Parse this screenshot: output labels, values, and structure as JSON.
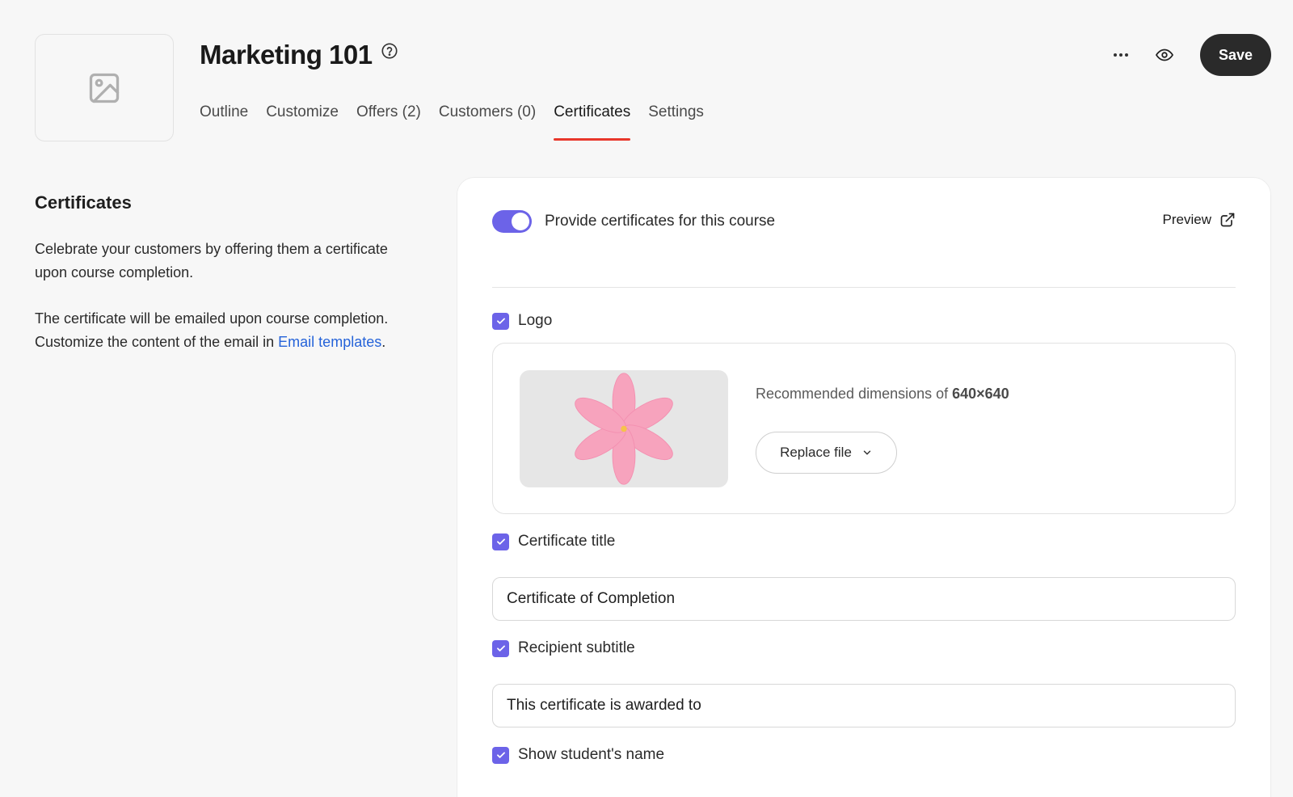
{
  "header": {
    "title": "Marketing 101",
    "thumbnail_icon": "image-placeholder-icon",
    "help_icon": "help-circle-icon",
    "save_label": "Save",
    "more_icon": "more-horizontal-icon",
    "preview_icon": "eye-icon"
  },
  "tabs": [
    {
      "label": "Outline",
      "active": false
    },
    {
      "label": "Customize",
      "active": false
    },
    {
      "label": "Offers (2)",
      "active": false
    },
    {
      "label": "Customers (0)",
      "active": false
    },
    {
      "label": "Certificates",
      "active": true
    },
    {
      "label": "Settings",
      "active": false
    }
  ],
  "left": {
    "heading": "Certificates",
    "para1": "Celebrate your customers by offering them a certificate upon course completion.",
    "para2_before": "The certificate will be emailed upon course completion. Customize the content of the email in ",
    "para2_link": "Email templates",
    "para2_after": "."
  },
  "card": {
    "toggle_label": "Provide certificates for this course",
    "toggle_on": true,
    "preview_label": "Preview",
    "logo": {
      "label": "Logo",
      "checked": true,
      "recommend_prefix": "Recommended dimensions of ",
      "recommend_dims": "640×640",
      "replace_label": "Replace file"
    },
    "certificate_title": {
      "label": "Certificate title",
      "checked": true,
      "value": "Certificate of Completion"
    },
    "recipient_subtitle": {
      "label": "Recipient subtitle",
      "checked": true,
      "value": "This certificate is awarded to"
    },
    "show_name": {
      "label": "Show student's name",
      "checked": true
    }
  },
  "colors": {
    "accent": "#6c63e8",
    "tab_underline": "#e8372b",
    "link": "#2563d9",
    "save_bg": "#2a2a2a"
  }
}
